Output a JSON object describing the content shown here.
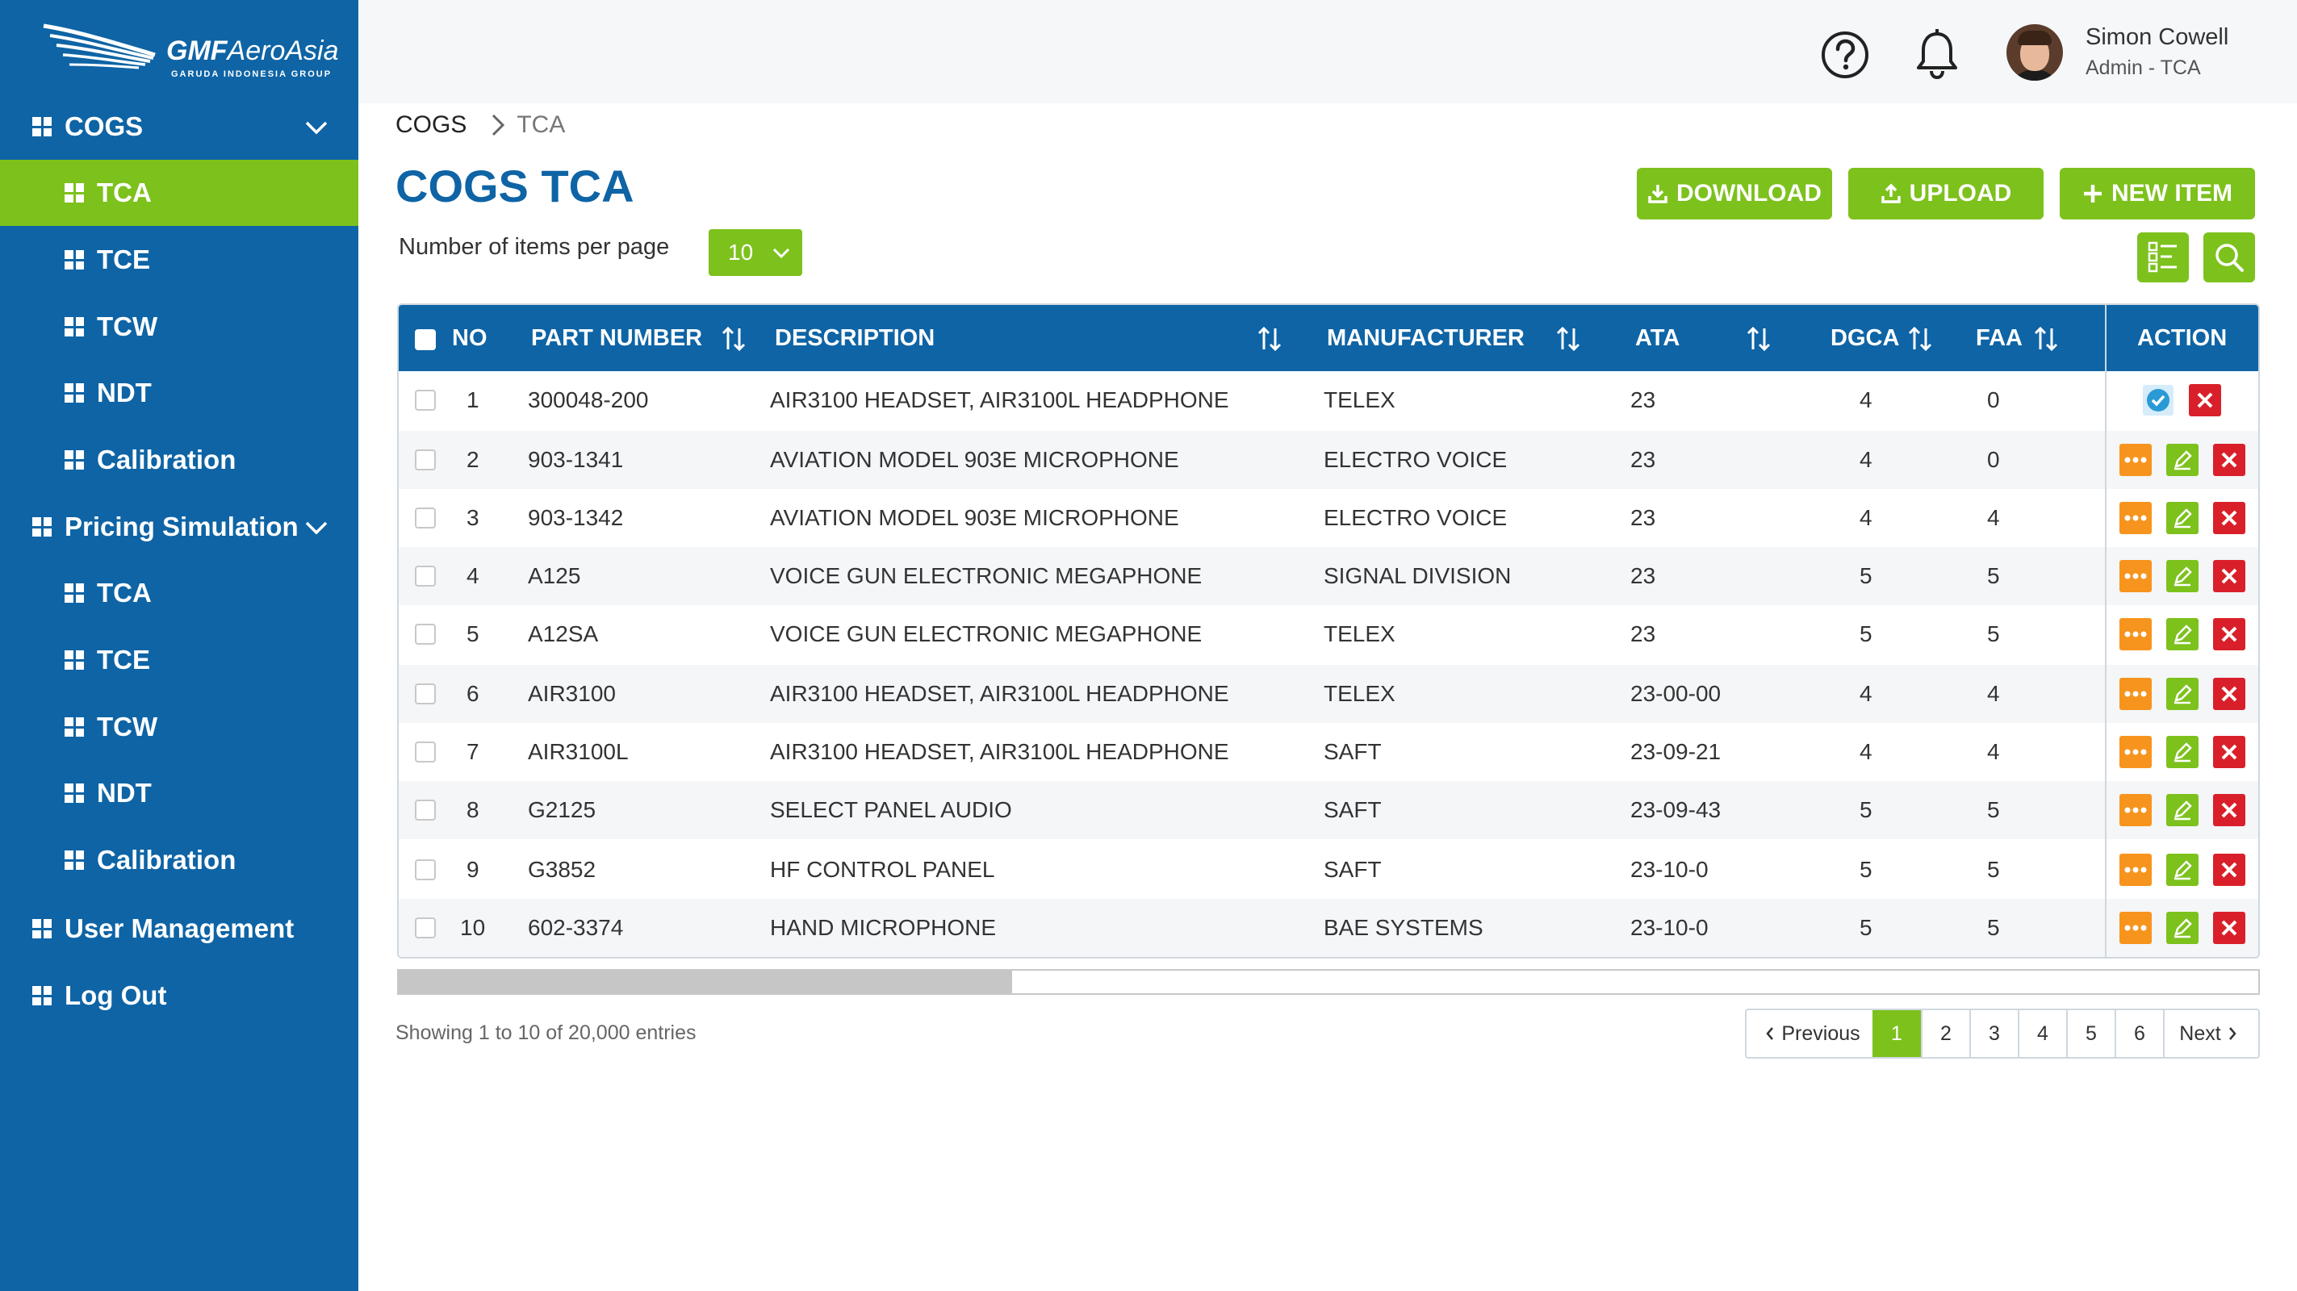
{
  "brand": {
    "name_bold": "GMF",
    "name_rest": "AeroAsia",
    "tagline": "GARUDA INDONESIA GROUP"
  },
  "sidebar": {
    "items": [
      {
        "label": "COGS",
        "level": "top",
        "expandable": true
      },
      {
        "label": "TCA",
        "level": "sub",
        "active": true
      },
      {
        "label": "TCE",
        "level": "sub"
      },
      {
        "label": "TCW",
        "level": "sub"
      },
      {
        "label": "NDT",
        "level": "sub"
      },
      {
        "label": "Calibration",
        "level": "sub"
      },
      {
        "label": "Pricing Simulation",
        "level": "top",
        "expandable": true
      },
      {
        "label": "TCA",
        "level": "sub"
      },
      {
        "label": "TCE",
        "level": "sub"
      },
      {
        "label": "TCW",
        "level": "sub"
      },
      {
        "label": "NDT",
        "level": "sub"
      },
      {
        "label": "Calibration",
        "level": "sub"
      },
      {
        "label": "User Management",
        "level": "top"
      },
      {
        "label": "Log Out",
        "level": "top"
      }
    ]
  },
  "header": {
    "user": {
      "name": "Simon Cowell",
      "role": "Admin - TCA"
    },
    "icons": [
      "help-icon",
      "bell-icon"
    ]
  },
  "breadcrumb": [
    "COGS",
    "TCA"
  ],
  "page_title": "COGS TCA",
  "per_page": {
    "label": "Number of items per page",
    "value": "10"
  },
  "actions": {
    "download": "DOWNLOAD",
    "upload": "UPLOAD",
    "new_item": "NEW ITEM"
  },
  "table": {
    "columns": [
      "NO",
      "PART NUMBER",
      "DESCRIPTION",
      "MANUFACTURER",
      "ATA",
      "DGCA",
      "FAA",
      "ACTION"
    ],
    "rows": [
      {
        "no": "1",
        "part": "300048-200",
        "desc": "AIR3100 HEADSET, AIR3100L HEADPHONE",
        "mfr": "TELEX",
        "ata": "23",
        "dgca": "4",
        "faa": "0"
      },
      {
        "no": "2",
        "part": "903-1341",
        "desc": "AVIATION MODEL 903E MICROPHONE",
        "mfr": "ELECTRO VOICE",
        "ata": "23",
        "dgca": "4",
        "faa": "0"
      },
      {
        "no": "3",
        "part": "903-1342",
        "desc": "AVIATION MODEL 903E MICROPHONE",
        "mfr": "ELECTRO VOICE",
        "ata": "23",
        "dgca": "4",
        "faa": "4"
      },
      {
        "no": "4",
        "part": "A125",
        "desc": "VOICE GUN ELECTRONIC MEGAPHONE",
        "mfr": "SIGNAL DIVISION",
        "ata": "23",
        "dgca": "5",
        "faa": "5"
      },
      {
        "no": "5",
        "part": "A12SA",
        "desc": "VOICE GUN ELECTRONIC MEGAPHONE",
        "mfr": "TELEX",
        "ata": "23",
        "dgca": "5",
        "faa": "5"
      },
      {
        "no": "6",
        "part": "AIR3100",
        "desc": "AIR3100 HEADSET, AIR3100L HEADPHONE",
        "mfr": "TELEX",
        "ata": "23-00-00",
        "dgca": "4",
        "faa": "4"
      },
      {
        "no": "7",
        "part": "AIR3100L",
        "desc": "AIR3100 HEADSET, AIR3100L HEADPHONE",
        "mfr": "SAFT",
        "ata": "23-09-21",
        "dgca": "4",
        "faa": "4"
      },
      {
        "no": "8",
        "part": "G2125",
        "desc": "SELECT PANEL AUDIO",
        "mfr": "SAFT",
        "ata": "23-09-43",
        "dgca": "5",
        "faa": "5"
      },
      {
        "no": "9",
        "part": "G3852",
        "desc": "HF CONTROL PANEL",
        "mfr": "SAFT",
        "ata": "23-10-0",
        "dgca": "5",
        "faa": "5"
      },
      {
        "no": "10",
        "part": "602-3374",
        "desc": "HAND MICROPHONE",
        "mfr": "BAE SYSTEMS",
        "ata": "23-10-0",
        "dgca": "5",
        "faa": "5"
      }
    ],
    "scroll_position": 0.0,
    "scroll_visible_fraction": 0.33
  },
  "footer": {
    "showing": "Showing 1 to 10 of 20,000 entries",
    "pagination": {
      "previous": "Previous",
      "next": "Next",
      "pages": [
        "1",
        "2",
        "3",
        "4",
        "5",
        "6"
      ],
      "current": "1"
    }
  },
  "colors": {
    "sidebar": "#0e64a5",
    "accent_green": "#7dc11d",
    "orange": "#f7941d",
    "red": "#d9202a",
    "title_blue": "#0e64a5"
  }
}
